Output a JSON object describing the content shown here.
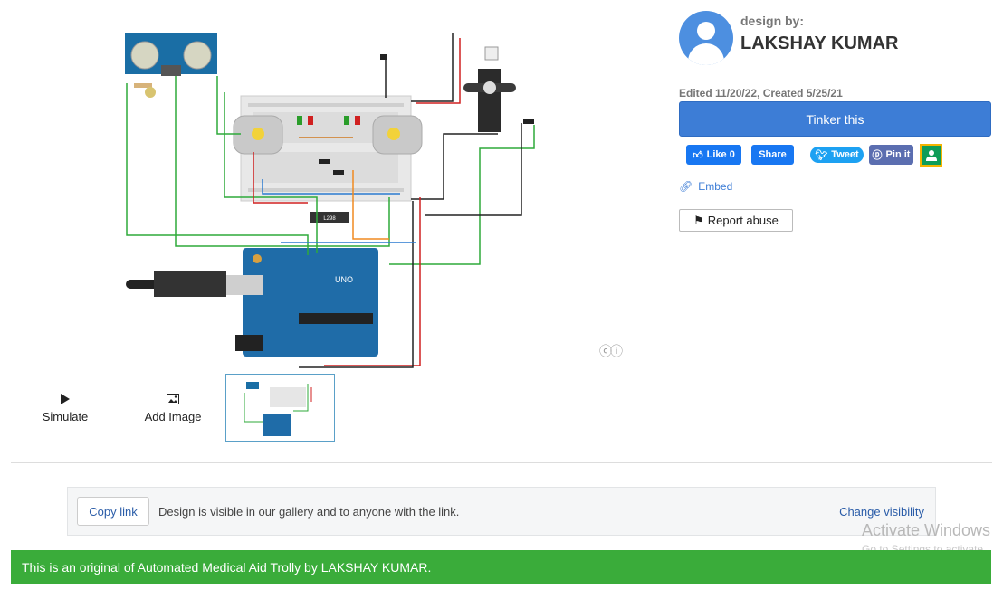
{
  "actions": {
    "simulate_label": "Simulate",
    "add_image_label": "Add Image"
  },
  "author": {
    "design_by_label": "design by:",
    "name": "LAKSHAY KUMAR",
    "dates": "Edited 11/20/22, Created 5/25/21"
  },
  "buttons": {
    "tinker_label": "Tinker this",
    "embed_label": "Embed",
    "report_label": "Report abuse"
  },
  "social": {
    "fb_like_label": "Like 0",
    "fb_share_label": "Share",
    "tweet_label": "Tweet",
    "pin_label": "Pin it"
  },
  "share_panel": {
    "copy_link_label": "Copy link",
    "visibility_text": "Design is visible in our gallery and to anyone with the link.",
    "change_visibility_label": "Change visibility"
  },
  "watermark": {
    "line1": "Activate Windows",
    "line2": "Go to Settings to activate"
  },
  "banner": {
    "text": "This is an original of Automated Medical Aid Trolly by LAKSHAY KUMAR."
  },
  "circuit_labels": {
    "ic_label": "L298",
    "board_label": "UNO"
  },
  "icons": {
    "simulate": "play-icon",
    "add_image": "image-icon",
    "embed": "link-icon",
    "report": "flag-icon",
    "cc": "creative-commons-icon",
    "classroom": "google-classroom-icon"
  },
  "colors": {
    "accent": "#3d7dd6",
    "banner": "#3aac3a",
    "facebook": "#1877f2",
    "twitter": "#1da1f2"
  }
}
